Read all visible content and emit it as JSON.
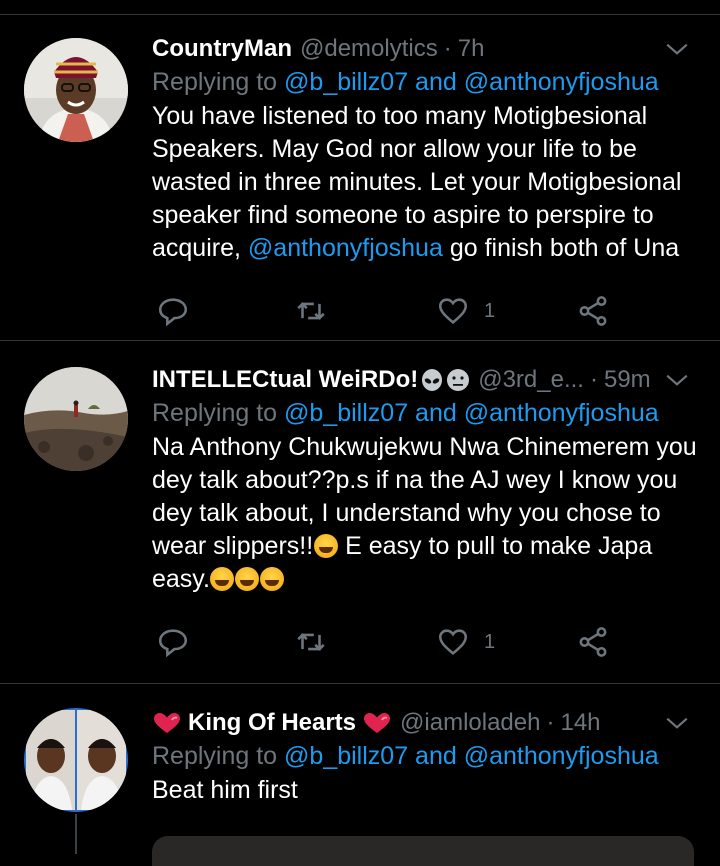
{
  "tweets": [
    {
      "name": "CountryMan",
      "handle": "@demolytics",
      "time": "7h",
      "reply_prefix": "Replying to",
      "reply_user1": "@b_billz07",
      "reply_and": "and",
      "reply_user2": "@anthonyfjoshua",
      "text1": "You have listened to too many Motigbesional Speakers. May God nor allow your life to be wasted in three minutes. Let your Motigbesional speaker find someone to aspire to perspire to acquire,",
      "mention": "@anthonyfjoshua",
      "text2": " go finish both of Una",
      "likes": "1"
    },
    {
      "name": "INTELLECtual WeiRDo!",
      "handle": "@3rd_e...",
      "time": "59m",
      "reply_prefix": "Replying to",
      "reply_user1": "@b_billz07",
      "reply_and": "and",
      "reply_user2": "@anthonyfjoshua",
      "text1": "Na Anthony Chukwujekwu Nwa Chinemerem you dey talk about??p.s if na the AJ wey I know you dey talk about, I understand why you chose to wear slippers!!",
      "text2": " E easy to pull to make Japa easy.",
      "likes": "1"
    },
    {
      "name": "King Of Hearts",
      "handle": "@iamloladeh",
      "time": "14h",
      "reply_prefix": "Replying to",
      "reply_user1": "@b_billz07",
      "reply_and": "and",
      "reply_user2": "@anthonyfjoshua",
      "text1": "Beat him first"
    }
  ],
  "colors": {
    "accent": "#1d9bf0",
    "muted": "#6e767d",
    "background": "#000000"
  },
  "icons": [
    "reply-icon",
    "retweet-icon",
    "like-icon",
    "share-icon",
    "chevron-down-icon"
  ]
}
